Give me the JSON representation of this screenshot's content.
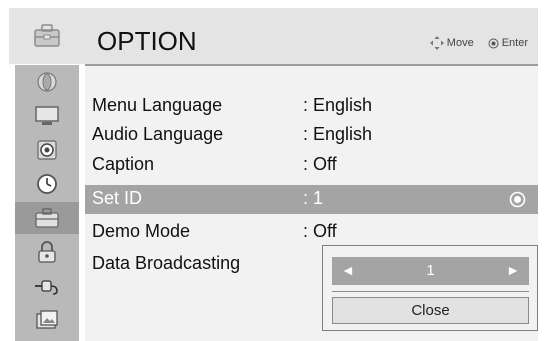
{
  "header": {
    "title": "OPTION",
    "move_label": "Move",
    "enter_label": "Enter"
  },
  "sidebar": {
    "top_icon": "option-toolbox-icon",
    "items": [
      {
        "icon": "satellite-dish-icon",
        "active": false
      },
      {
        "icon": "monitor-icon",
        "active": false
      },
      {
        "icon": "speaker-icon",
        "active": false
      },
      {
        "icon": "clock-icon",
        "active": false
      },
      {
        "icon": "toolbox-icon",
        "active": true
      },
      {
        "icon": "lock-icon",
        "active": false
      },
      {
        "icon": "input-plug-icon",
        "active": false
      },
      {
        "icon": "photo-media-icon",
        "active": false
      }
    ]
  },
  "menu": {
    "items": [
      {
        "label": "Menu Language",
        "value": ": English"
      },
      {
        "label": "Audio Language",
        "value": ": English"
      },
      {
        "label": "Caption",
        "value": ": Off"
      },
      {
        "label": "Set ID",
        "value": ": 1",
        "selected": true
      },
      {
        "label": "Demo Mode",
        "value": ": Off"
      },
      {
        "label": "Data Broadcasting",
        "value": ""
      }
    ]
  },
  "popup": {
    "value": "1",
    "close_label": "Close"
  },
  "colors": {
    "selection": "#a4a4a4",
    "sidebar": "#b9b9b9",
    "header": "#e4e4e4",
    "panel": "#f2f2f2"
  }
}
